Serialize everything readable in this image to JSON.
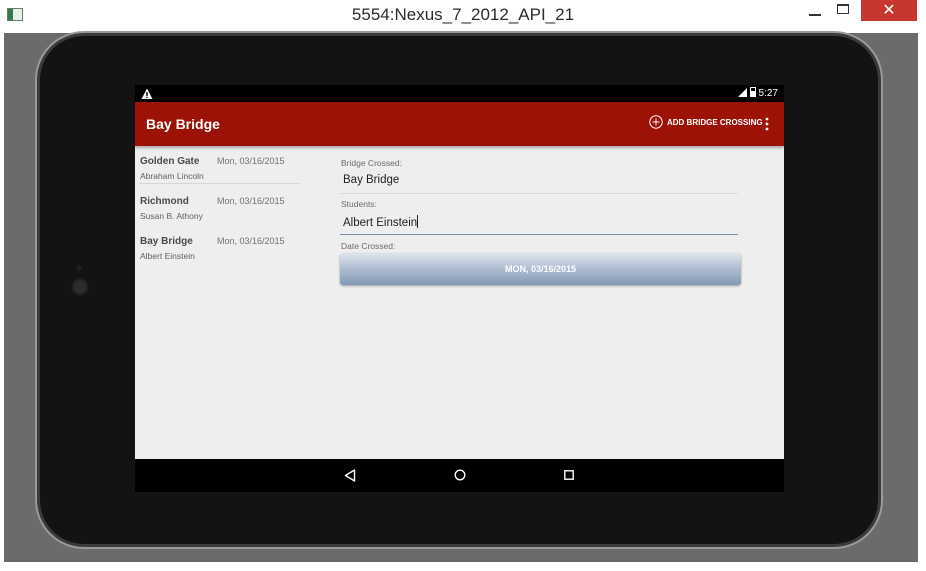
{
  "window": {
    "title": "5554:Nexus_7_2012_API_21",
    "close_glyph": "✕"
  },
  "statusbar": {
    "time": "5:27"
  },
  "appbar": {
    "title": "Bay Bridge",
    "add_label": "ADD BRIDGE CROSSING"
  },
  "list": {
    "items": [
      {
        "bridge": "Golden Gate",
        "student": "Abraham Lincoln",
        "date": "Mon, 03/16/2015"
      },
      {
        "bridge": "Richmond",
        "student": "Susan B. Athony",
        "date": "Mon, 03/16/2015"
      },
      {
        "bridge": "Bay Bridge",
        "student": "Albert Einstein",
        "date": "Mon, 03/16/2015"
      }
    ]
  },
  "detail": {
    "bridge_label": "Bridge Crossed:",
    "bridge_value": "Bay Bridge",
    "students_label": "Students:",
    "students_value": "Albert Einstein",
    "date_label": "Date Crossed:",
    "date_button": "MON, 03/16/2015"
  },
  "colors": {
    "appbar": "#9c1206",
    "date_button": "#8397b5"
  }
}
